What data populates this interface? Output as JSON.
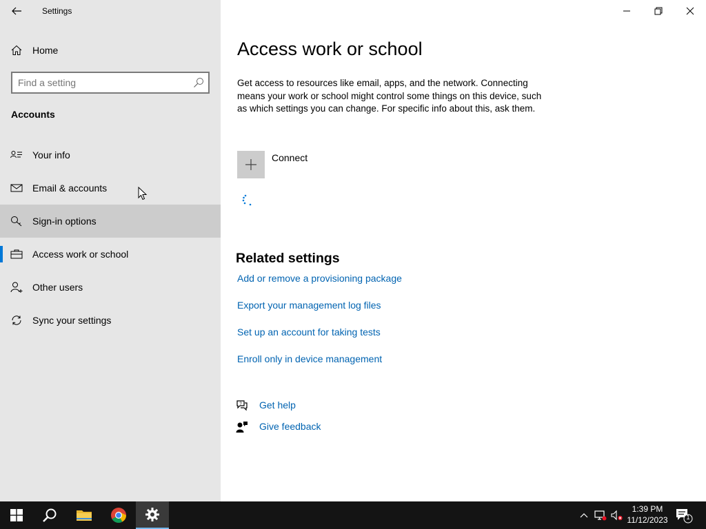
{
  "window": {
    "title": "Settings"
  },
  "sidebar": {
    "home_label": "Home",
    "search_placeholder": "Find a setting",
    "section_title": "Accounts",
    "items": [
      {
        "label": "Your info",
        "icon": "contact-card-icon"
      },
      {
        "label": "Email & accounts",
        "icon": "mail-icon"
      },
      {
        "label": "Sign-in options",
        "icon": "key-icon",
        "state": "hover"
      },
      {
        "label": "Access work or school",
        "icon": "briefcase-icon",
        "state": "selected"
      },
      {
        "label": "Other users",
        "icon": "person-add-icon"
      },
      {
        "label": "Sync your settings",
        "icon": "sync-icon"
      }
    ]
  },
  "main": {
    "title": "Access work or school",
    "description": "Get access to resources like email, apps, and the network. Connecting means your work or school might control some things on this device, such as which settings you can change. For specific info about this, ask them.",
    "connect_label": "Connect",
    "related_title": "Related settings",
    "links": [
      "Add or remove a provisioning package",
      "Export your management log files",
      "Set up an account for taking tests",
      "Enroll only in device management"
    ],
    "help": {
      "get_help": "Get help",
      "give_feedback": "Give feedback"
    }
  },
  "taskbar": {
    "time": "1:39 PM",
    "date": "11/12/2023",
    "notification_count": "1"
  },
  "colors": {
    "accent": "#0078d7",
    "link": "#0063b1",
    "sidebar_bg": "#e6e6e6",
    "hover_bg": "#cccccc",
    "taskbar_bg": "#141414"
  }
}
